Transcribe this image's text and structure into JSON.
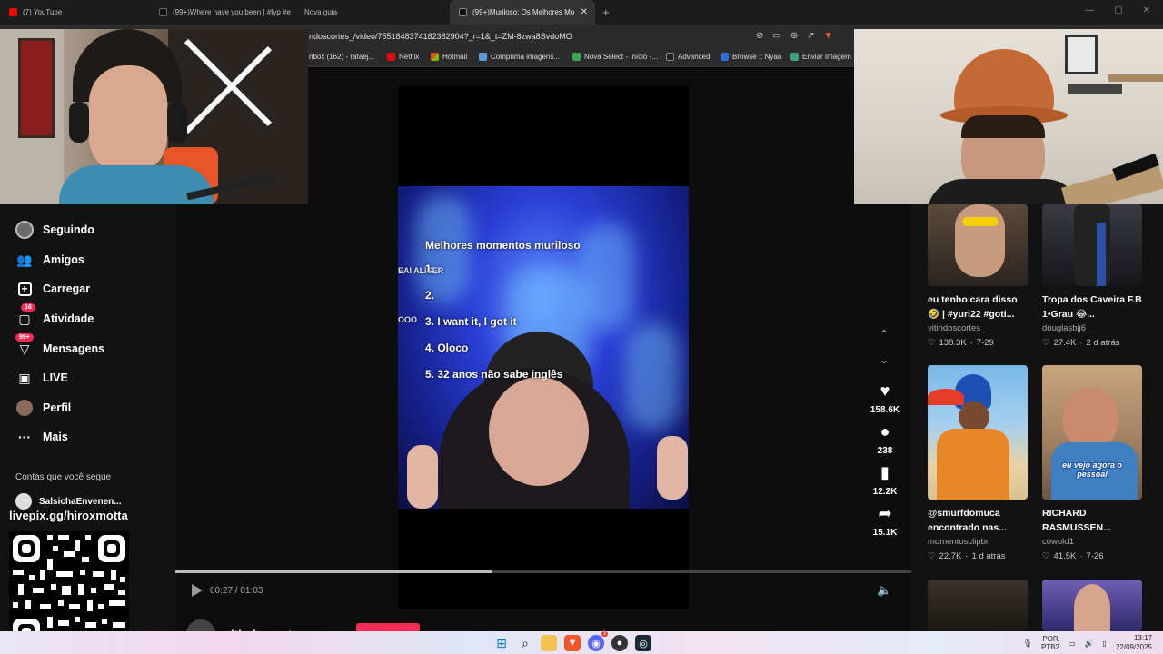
{
  "browser": {
    "tabs": [
      {
        "label": "(7) YouTube",
        "active": false,
        "fav_color": "#ff0000"
      },
      {
        "label": "(99+)Where have you been | #fyp #e",
        "active": false,
        "fav_color": "#111111"
      },
      {
        "label": "Nova guia",
        "active": false,
        "fav_color": "#444444"
      },
      {
        "label": "(99+)Muriloso: Os Melhores Mo",
        "active": true,
        "fav_color": "#111111"
      }
    ],
    "new_tab": "+",
    "url": "ndoscortes_/video/7551848374182382904?_r=1&_t=ZM-8zwa8SvdoMO",
    "bookmarks": [
      {
        "label": "nbox (162) - rafaej...",
        "color": "#4a90e2"
      },
      {
        "label": "Netflix",
        "color": "#e50914"
      },
      {
        "label": "Hotmail",
        "color": "#f25022"
      },
      {
        "label": "Comprima imagens...",
        "color": "#5b9bd5"
      },
      {
        "label": "Nova Select - Início -...",
        "color": "#36a852"
      },
      {
        "label": "Advanced",
        "color": "#888888"
      },
      {
        "label": "Browse :: Nyaa",
        "color": "#2f6fd6"
      },
      {
        "label": "Enviar Imagem",
        "color": "#3aa17e"
      }
    ]
  },
  "nav": {
    "items": [
      {
        "label": "Seguindo",
        "icon": "avatar-icon"
      },
      {
        "label": "Amigos",
        "icon": "friends-icon"
      },
      {
        "label": "Carregar",
        "icon": "upload-icon"
      },
      {
        "label": "Atividade",
        "icon": "activity-icon",
        "badge": "16"
      },
      {
        "label": "Mensagens",
        "icon": "messages-icon",
        "badge": "99+"
      },
      {
        "label": "LIVE",
        "icon": "live-icon"
      },
      {
        "label": "Perfil",
        "icon": "profile-icon"
      },
      {
        "label": "Mais",
        "icon": "more-icon"
      }
    ],
    "following_title": "Contas que você segue",
    "following_first": "SalsichaEnvenen..."
  },
  "video": {
    "lines": [
      "Melhores momentos muriloso",
      "1.",
      "2.",
      "3. I want it, I got it",
      "4. Oloco",
      "5. 32 anos não sabe inglês"
    ],
    "background_fragments": [
      "EAI ALISER",
      "OOO"
    ],
    "time": "00:27 / 01:03",
    "progress": 0.43,
    "author": "vitindoscortes"
  },
  "actions": {
    "likes": "158.6K",
    "comments": "238",
    "saves": "12.2K",
    "shares": "15.1K"
  },
  "recommended": [
    {
      "title": "eu tenho cara disso 🤣 | #yuri22 #goti...",
      "author": "vitindoscortes_",
      "likes": "138.3K",
      "date": "7-29"
    },
    {
      "title": "Tropa dos Caveira F.B 1•Grau 😂...",
      "author": "douglasbjj6",
      "likes": "27.4K",
      "date": "2 d atrás"
    },
    {
      "title": "@smurfdomuca encontrado nas...",
      "author": "momentosclipbr",
      "likes": "22.7K",
      "date": "1 d atrás"
    },
    {
      "title": "RICHARD RASMUSSEN...",
      "author": "cowold1",
      "likes": "41.5K",
      "date": "7-26",
      "caption": "eu vejo agora o pessoal"
    }
  ],
  "overlay": {
    "livepix": "livepix.gg/hiroxmotta"
  },
  "taskbar": {
    "lang_top": "POR",
    "lang_bottom": "PTB2",
    "time": "13:17",
    "date": "22/09/2025",
    "badge": "3"
  },
  "colors": {
    "accent": "#fe2c55",
    "page_bg": "#121212"
  }
}
